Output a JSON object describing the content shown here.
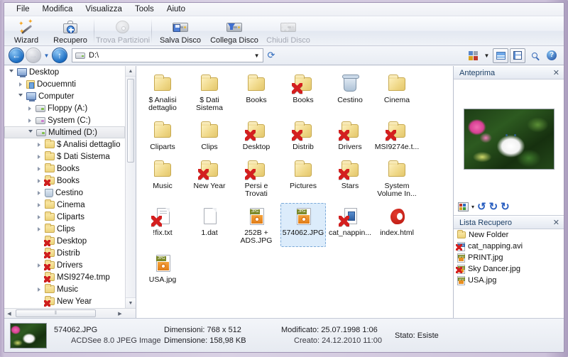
{
  "menu": {
    "items": [
      "File",
      "Modifica",
      "Visualizza",
      "Tools",
      "Aiuto"
    ]
  },
  "toolbar": {
    "buttons": [
      {
        "label": "Wizard",
        "icon": "wizard-icon",
        "disabled": false
      },
      {
        "label": "Recupero",
        "icon": "recovery-briefcase-icon",
        "disabled": false
      },
      {
        "label": "Trova Partizioni",
        "icon": "disk-platter-icon",
        "disabled": true
      },
      {
        "label": "Salva Disco",
        "icon": "save-disk-icon",
        "disabled": false
      },
      {
        "label": "Collega Disco",
        "icon": "attach-disk-icon",
        "disabled": false
      },
      {
        "label": "Chiudi Disco",
        "icon": "close-disk-icon",
        "disabled": true
      }
    ]
  },
  "address": {
    "back_label": "←",
    "forward_label": "→",
    "up_label": "↑",
    "value": "D:\\",
    "placeholder": "D:\\",
    "refresh_icon": "refresh-icon",
    "views_icon": "view-mode-icon",
    "properties_icon": "properties-icon",
    "save_icon": "save-icon",
    "search_icon": "search-icon",
    "help_icon": "help-icon"
  },
  "tree": {
    "items": [
      {
        "label": "Desktop",
        "indent": 0,
        "twisty": "open",
        "icon": "monitor-icon",
        "selected": false
      },
      {
        "label": "Docuemnti",
        "indent": 1,
        "twisty": "closed",
        "icon": "documents-icon",
        "selected": false
      },
      {
        "label": "Computer",
        "indent": 1,
        "twisty": "open",
        "icon": "computer-icon",
        "selected": false
      },
      {
        "label": "Floppy (A:)",
        "indent": 2,
        "twisty": "closed",
        "icon": "floppy-drive-icon",
        "selected": false
      },
      {
        "label": "System (C:)",
        "indent": 2,
        "twisty": "closed",
        "icon": "system-drive-icon",
        "selected": false
      },
      {
        "label": "Multimed (D:)",
        "indent": 2,
        "twisty": "open",
        "icon": "drive-icon",
        "selected": true
      },
      {
        "label": "$ Analisi dettaglio",
        "indent": 3,
        "twisty": "closed",
        "icon": "folder-icon",
        "selected": false
      },
      {
        "label": "$ Dati Sistema",
        "indent": 3,
        "twisty": "closed",
        "icon": "folder-icon",
        "selected": false
      },
      {
        "label": "Books",
        "indent": 3,
        "twisty": "closed",
        "icon": "folder-icon",
        "selected": false
      },
      {
        "label": "Books",
        "indent": 3,
        "twisty": "closed",
        "icon": "folder-deleted-icon",
        "selected": false
      },
      {
        "label": "Cestino",
        "indent": 3,
        "twisty": "closed",
        "icon": "recycle-bin-icon",
        "selected": false
      },
      {
        "label": "Cinema",
        "indent": 3,
        "twisty": "closed",
        "icon": "folder-icon",
        "selected": false
      },
      {
        "label": "Cliparts",
        "indent": 3,
        "twisty": "closed",
        "icon": "folder-icon",
        "selected": false
      },
      {
        "label": "Clips",
        "indent": 3,
        "twisty": "closed",
        "icon": "folder-icon",
        "selected": false
      },
      {
        "label": "Desktop",
        "indent": 3,
        "twisty": "none",
        "icon": "folder-deleted-icon",
        "selected": false
      },
      {
        "label": "Distrib",
        "indent": 3,
        "twisty": "none",
        "icon": "folder-deleted-icon",
        "selected": false
      },
      {
        "label": "Drivers",
        "indent": 3,
        "twisty": "closed",
        "icon": "folder-deleted-icon",
        "selected": false
      },
      {
        "label": "MSI9274e.tmp",
        "indent": 3,
        "twisty": "none",
        "icon": "folder-deleted-icon",
        "selected": false
      },
      {
        "label": "Music",
        "indent": 3,
        "twisty": "closed",
        "icon": "folder-icon",
        "selected": false
      },
      {
        "label": "New Year",
        "indent": 3,
        "twisty": "none",
        "icon": "folder-deleted-icon",
        "selected": false
      },
      {
        "label": "Persi e Trovati",
        "indent": 3,
        "twisty": "closed",
        "icon": "folder-deleted-icon",
        "selected": false
      },
      {
        "label": "Pictures",
        "indent": 3,
        "twisty": "closed",
        "icon": "folder-icon",
        "selected": false
      },
      {
        "label": "Stars",
        "indent": 3,
        "twisty": "closed",
        "icon": "folder-deleted-icon",
        "selected": false
      }
    ]
  },
  "files": {
    "items": [
      {
        "name": "$ Analisi dettaglio",
        "type": "folder",
        "selected": false
      },
      {
        "name": "$ Dati Sistema",
        "type": "folder",
        "selected": false
      },
      {
        "name": "Books",
        "type": "folder",
        "selected": false
      },
      {
        "name": "Books",
        "type": "folder-deleted",
        "selected": false
      },
      {
        "name": "Cestino",
        "type": "recycle-bin",
        "selected": false
      },
      {
        "name": "Cinema",
        "type": "folder",
        "selected": false
      },
      {
        "name": "Cliparts",
        "type": "folder",
        "selected": false
      },
      {
        "name": "Clips",
        "type": "folder",
        "selected": false
      },
      {
        "name": "Desktop",
        "type": "folder-deleted",
        "selected": false
      },
      {
        "name": "Distrib",
        "type": "folder-deleted",
        "selected": false
      },
      {
        "name": "Drivers",
        "type": "folder-deleted",
        "selected": false
      },
      {
        "name": "MSI9274e.t...",
        "type": "folder-deleted",
        "selected": false
      },
      {
        "name": "Music",
        "type": "folder",
        "selected": false
      },
      {
        "name": "New Year",
        "type": "folder-deleted",
        "selected": false
      },
      {
        "name": "Persi e Trovati",
        "type": "folder-deleted",
        "selected": false
      },
      {
        "name": "Pictures",
        "type": "folder",
        "selected": false
      },
      {
        "name": "Stars",
        "type": "folder-deleted",
        "selected": false
      },
      {
        "name": "System Volume In...",
        "type": "folder",
        "selected": false
      },
      {
        "name": "!fix.txt",
        "type": "text-deleted",
        "selected": false
      },
      {
        "name": "1.dat",
        "type": "blank-doc",
        "selected": false
      },
      {
        "name": "252B + ADS.JPG",
        "type": "jpeg",
        "selected": false
      },
      {
        "name": "574062.JPG",
        "type": "jpeg",
        "selected": true
      },
      {
        "name": "cat_nappin...",
        "type": "avi-deleted",
        "selected": false
      },
      {
        "name": "index.html",
        "type": "html",
        "selected": false
      },
      {
        "name": "USA.jpg",
        "type": "jpeg",
        "selected": false
      }
    ]
  },
  "preview": {
    "title": "Anteprima",
    "close_label": "✕",
    "image_alt": "white-cat-in-garden-thumbnail",
    "tools": {
      "palette_icon": "palette-icon",
      "caret_label": "▾",
      "rotate_left": "↺",
      "rotate_180": "↻",
      "rotate_right": "↻"
    }
  },
  "recovery_list": {
    "title": "Lista Recupero",
    "close_label": "✕",
    "items": [
      {
        "label": "New Folder",
        "icon": "folder-icon"
      },
      {
        "label": "cat_napping.avi",
        "icon": "avi-deleted-icon"
      },
      {
        "label": "PRINT.jpg",
        "icon": "jpeg-icon"
      },
      {
        "label": "Sky Dancer.jpg",
        "icon": "jpeg-deleted-icon"
      },
      {
        "label": "USA.jpg",
        "icon": "jpeg-icon"
      }
    ]
  },
  "statusbar": {
    "thumb_alt": "selected-file-thumbnail",
    "filename": "574062.JPG",
    "filetype": "ACDSee 8.0 JPEG Image",
    "dimensions_label": "Dimensioni: 768 x 512",
    "size_label": "Dimensione: 158,98 KB",
    "modified_label": "Modificato: 25.07.1998 1:06",
    "created_label": "Creato: 24.12.2010 11:00",
    "state_label": "Stato: Esiste"
  },
  "scrollbars": {
    "up_arrow": "▲",
    "down_arrow": "▼",
    "left_arrow": "◀",
    "right_arrow": "▶",
    "grip": "‖"
  },
  "colors": {
    "frame": "#c9bfd8",
    "accent": "#2f6bbd",
    "folder": "#edd27a",
    "deleted_marker": "#d41f1f",
    "selection": "#dcecfb"
  }
}
